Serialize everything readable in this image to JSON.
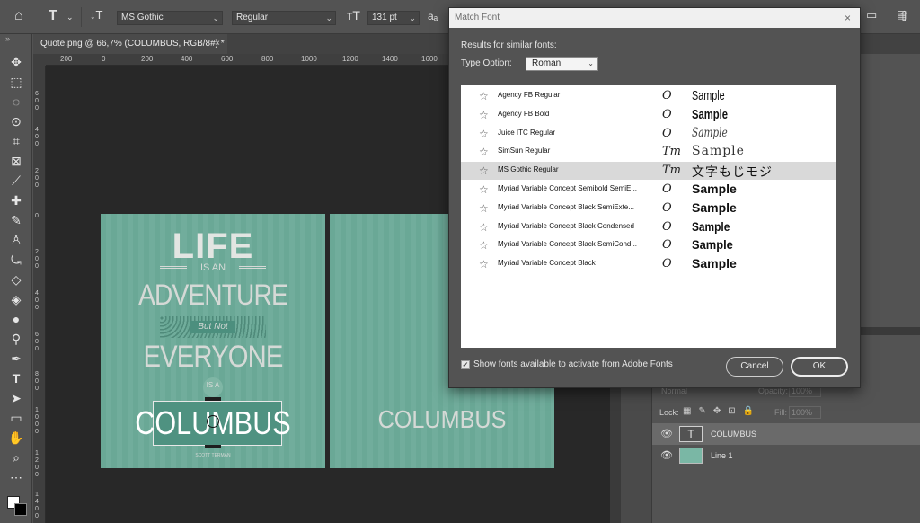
{
  "options_bar": {
    "font_family": "MS Gothic",
    "font_style": "Regular",
    "font_size": "131 pt",
    "antialias": "aₐ"
  },
  "document_tab": {
    "title": "Quote.png @ 66,7% (COLUMBUS, RGB/8#) *",
    "close": "×"
  },
  "ruler": {
    "horizontal": [
      "200",
      "0",
      "200",
      "400",
      "600",
      "800",
      "1000",
      "1200",
      "1400",
      "1600"
    ],
    "vertical": [
      "6 0 0",
      "4 0 0",
      "2 0 0",
      "0",
      "2 0 0",
      "4 0 0",
      "6 0 0",
      "8 0 0",
      "1 0 0 0",
      "1 2 0 0",
      "1 4 0 0"
    ]
  },
  "poster": {
    "life": "LIFE",
    "is_an": "IS AN",
    "adventure": "ADVENTURE",
    "but_not": "But Not",
    "everyone": "EVERYONE",
    "is_a": "IS A",
    "columbus": "COLUMBUS",
    "author": "SCOTT TERMAN",
    "columbus_right": "COLUMBUS"
  },
  "dialog": {
    "title": "Match Font",
    "close": "×",
    "results_label": "Results for similar fonts:",
    "type_option_label": "Type Option:",
    "type_option_value": "Roman",
    "fonts": [
      {
        "name": "Agency FB Regular",
        "type": "O",
        "sample": "Sample",
        "selected": false
      },
      {
        "name": "Agency FB Bold",
        "type": "O",
        "sample": "Sample",
        "selected": false
      },
      {
        "name": "Juice ITC Regular",
        "type": "O",
        "sample": "Sample",
        "selected": false
      },
      {
        "name": "SimSun Regular",
        "type": "Tт",
        "sample": "Sample",
        "selected": false
      },
      {
        "name": "MS Gothic Regular",
        "type": "Tт",
        "sample": "文字もじモジ",
        "selected": true
      },
      {
        "name": "Myriad Variable Concept Semibold SemiE...",
        "type": "O",
        "sample": "Sample",
        "selected": false
      },
      {
        "name": "Myriad Variable Concept Black SemiExte...",
        "type": "O",
        "sample": "Sample",
        "selected": false
      },
      {
        "name": "Myriad Variable Concept Black Condensed",
        "type": "O",
        "sample": "Sample",
        "selected": false
      },
      {
        "name": "Myriad Variable Concept Black SemiCond...",
        "type": "O",
        "sample": "Sample",
        "selected": false
      },
      {
        "name": "Myriad Variable Concept Black",
        "type": "O",
        "sample": "Sample",
        "selected": false
      }
    ],
    "show_fonts_label": "Show fonts available to activate from Adobe Fonts",
    "show_fonts_checked": "✓",
    "cancel_label": "Cancel",
    "ok_label": "OK"
  },
  "layers_panel": {
    "blend_mode": "Normal",
    "opacity_label": "Opacity:",
    "opacity_value": "100%",
    "lock_label": "Lock:",
    "fill_label": "Fill:",
    "fill_value": "100%",
    "layers": [
      {
        "name": "COLUMBUS",
        "thumb": "T"
      },
      {
        "name": "Line 1",
        "thumb": ""
      }
    ]
  },
  "colors": {
    "poster_bg": "#6aa896",
    "poster_text": "#d5d9d6",
    "workarea": "#282828",
    "panel": "#535353"
  }
}
